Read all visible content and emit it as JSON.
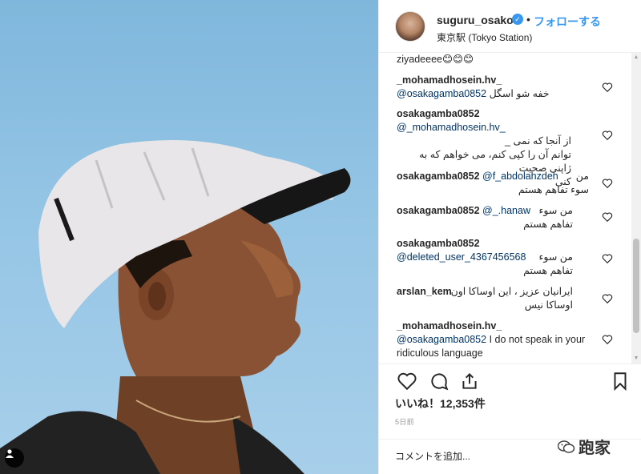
{
  "post": {
    "username": "suguru_osako",
    "verified_mark": "✓",
    "separator": "•",
    "follow_label": "フォローする",
    "location": "東京駅 (Tokyo Station)"
  },
  "comments": [
    {
      "name": "",
      "text": "ziyadeeee😊😊😊"
    },
    {
      "name": "_mohamadhosein.hv_",
      "mention": "@osakagamba0852",
      "text": "خفه شو اسگل"
    },
    {
      "name": "osakagamba0852",
      "mention": "@_mohamadhosein.hv_",
      "text": "از آنجا که نمی _\nتوانم آن را کپی کنم، می خواهم که به ژاپنی صحبت\nکنی"
    },
    {
      "name": "osakagamba0852",
      "mention": "@f_abdolahzdeh",
      "text": "من\nسوء تفاهم هستم"
    },
    {
      "name": "osakagamba0852",
      "mention": "@_.hanaw",
      "text": "من سوء\nتفاهم هستم"
    },
    {
      "name": "osakagamba0852",
      "mention": "@deleted_user_4367456568",
      "text": "من سوء\nتفاهم هستم"
    },
    {
      "name": "arslan_kem",
      "mention": "",
      "text": "ایرانیان عزیز ، این اوساکا اون\nاوساکا نیس"
    },
    {
      "name": "_mohamadhosein.hv_",
      "mention": "@osakagamba0852",
      "text": "I do not speak in your ridiculous language"
    }
  ],
  "actions": {
    "likes_label": "いいね！12,353件",
    "date_label": "5日前",
    "comment_placeholder": "コメントを追加..."
  },
  "watermark": {
    "text": "跑家"
  },
  "icons": {
    "like": "heart-icon",
    "comment": "comment-icon",
    "share": "share-icon",
    "save": "bookmark-icon",
    "user_tag": "person-icon"
  },
  "colors": {
    "link_blue": "#3897f0",
    "mention": "#003569",
    "sky": "#95c5e5"
  }
}
